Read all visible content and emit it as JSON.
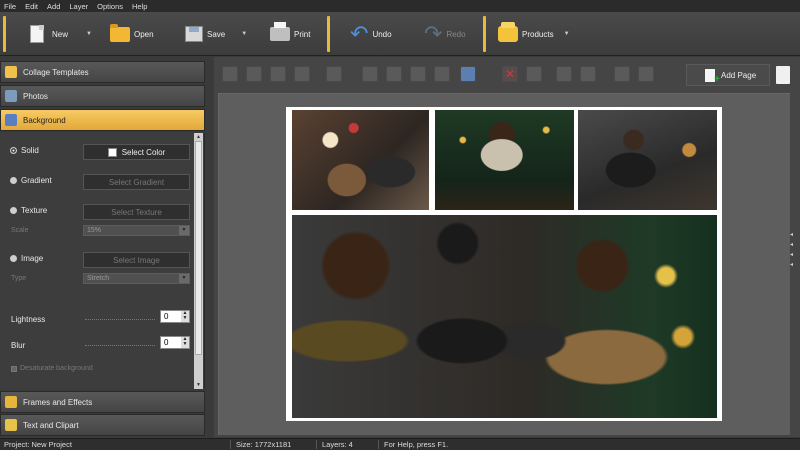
{
  "menu": [
    "File",
    "Edit",
    "Add",
    "Layer",
    "Options",
    "Help"
  ],
  "ribbon": {
    "new": "New",
    "open": "Open",
    "save": "Save",
    "print": "Print",
    "undo": "Undo",
    "redo": "Redo",
    "products": "Products"
  },
  "sidebar": {
    "sections": {
      "collage_templates": "Collage Templates",
      "photos": "Photos",
      "background": "Background",
      "frames_effects": "Frames and Effects",
      "text_clipart": "Text and Clipart"
    },
    "background": {
      "solid": "Solid",
      "select_color": "Select Color",
      "gradient": "Gradient",
      "select_gradient": "Select Gradient",
      "texture": "Texture",
      "select_texture": "Select Texture",
      "scale_label": "Scale",
      "scale_value": "15%",
      "image": "Image",
      "select_image": "Select Image",
      "type_label": "Type",
      "type_value": "Stretch",
      "lightness_label": "Lightness",
      "lightness_value": "0",
      "blur_label": "Blur",
      "blur_value": "0",
      "desaturate": "Desaturate background"
    }
  },
  "toolbar": {
    "add_page": "Add Page"
  },
  "status": {
    "project": "Project: New Project",
    "size": "Size: 1772x1181",
    "layers": "Layers: 4",
    "help": "For Help, press F1."
  },
  "colors": {
    "accent": "#e8b93a",
    "panel": "#3d3d3d",
    "workspace": "#5e5e5e"
  }
}
